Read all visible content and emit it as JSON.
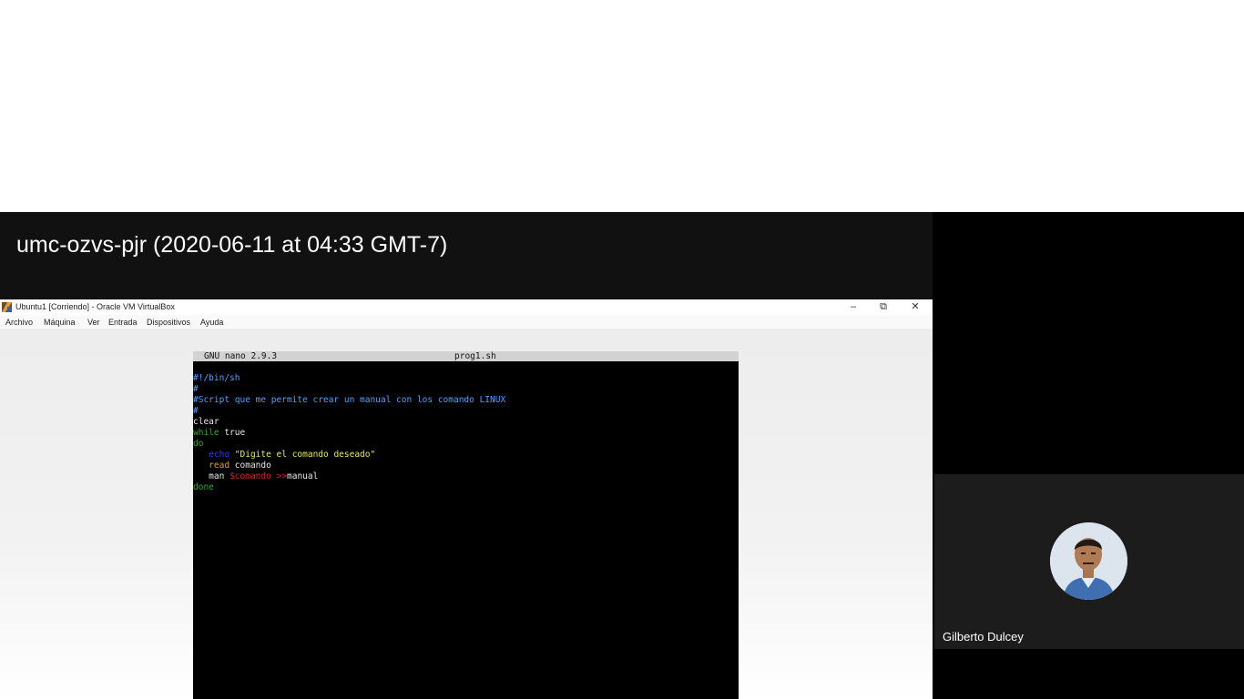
{
  "recording": {
    "title": "umc-ozvs-pjr (2020-06-11 at 04:33 GMT-7)"
  },
  "virtualbox": {
    "window_title": "Ubuntu1 [Corriendo] - Oracle VM VirtualBox",
    "minimize": "–",
    "restore": "⧉",
    "close": "✕",
    "menu": [
      "Archivo",
      "Máquina",
      "Ver",
      "Entrada",
      "Dispositivos",
      "Ayuda"
    ]
  },
  "nano": {
    "version": "GNU nano 2.9.3",
    "filename": "prog1.sh",
    "lines": {
      "l1": "#!/bin/sh",
      "l2": "#",
      "l3": "#Script que me permite crear un manual con los comando LINUX",
      "l4": "#",
      "l5": "clear",
      "l6_kw": "while",
      "l6_rest": " true",
      "l7": "do",
      "l8_indent": "   ",
      "l8_kw": "echo",
      "l8_str": " \"Digite el comando deseado\"",
      "l9_kw": "read",
      "l9_rest": " comando",
      "l10_kw": "man",
      "l10_var": " $comando",
      "l10_op": " >>",
      "l10_rest": "manual",
      "l11": "done"
    }
  },
  "participant": {
    "name": "Gilberto Dulcey"
  },
  "colors": {
    "comment": "#4aa3ff",
    "keyword_green": "#2fa82f",
    "keyword_blue": "#2a3bff",
    "string": "#e8e85a",
    "variable": "#e02020"
  }
}
